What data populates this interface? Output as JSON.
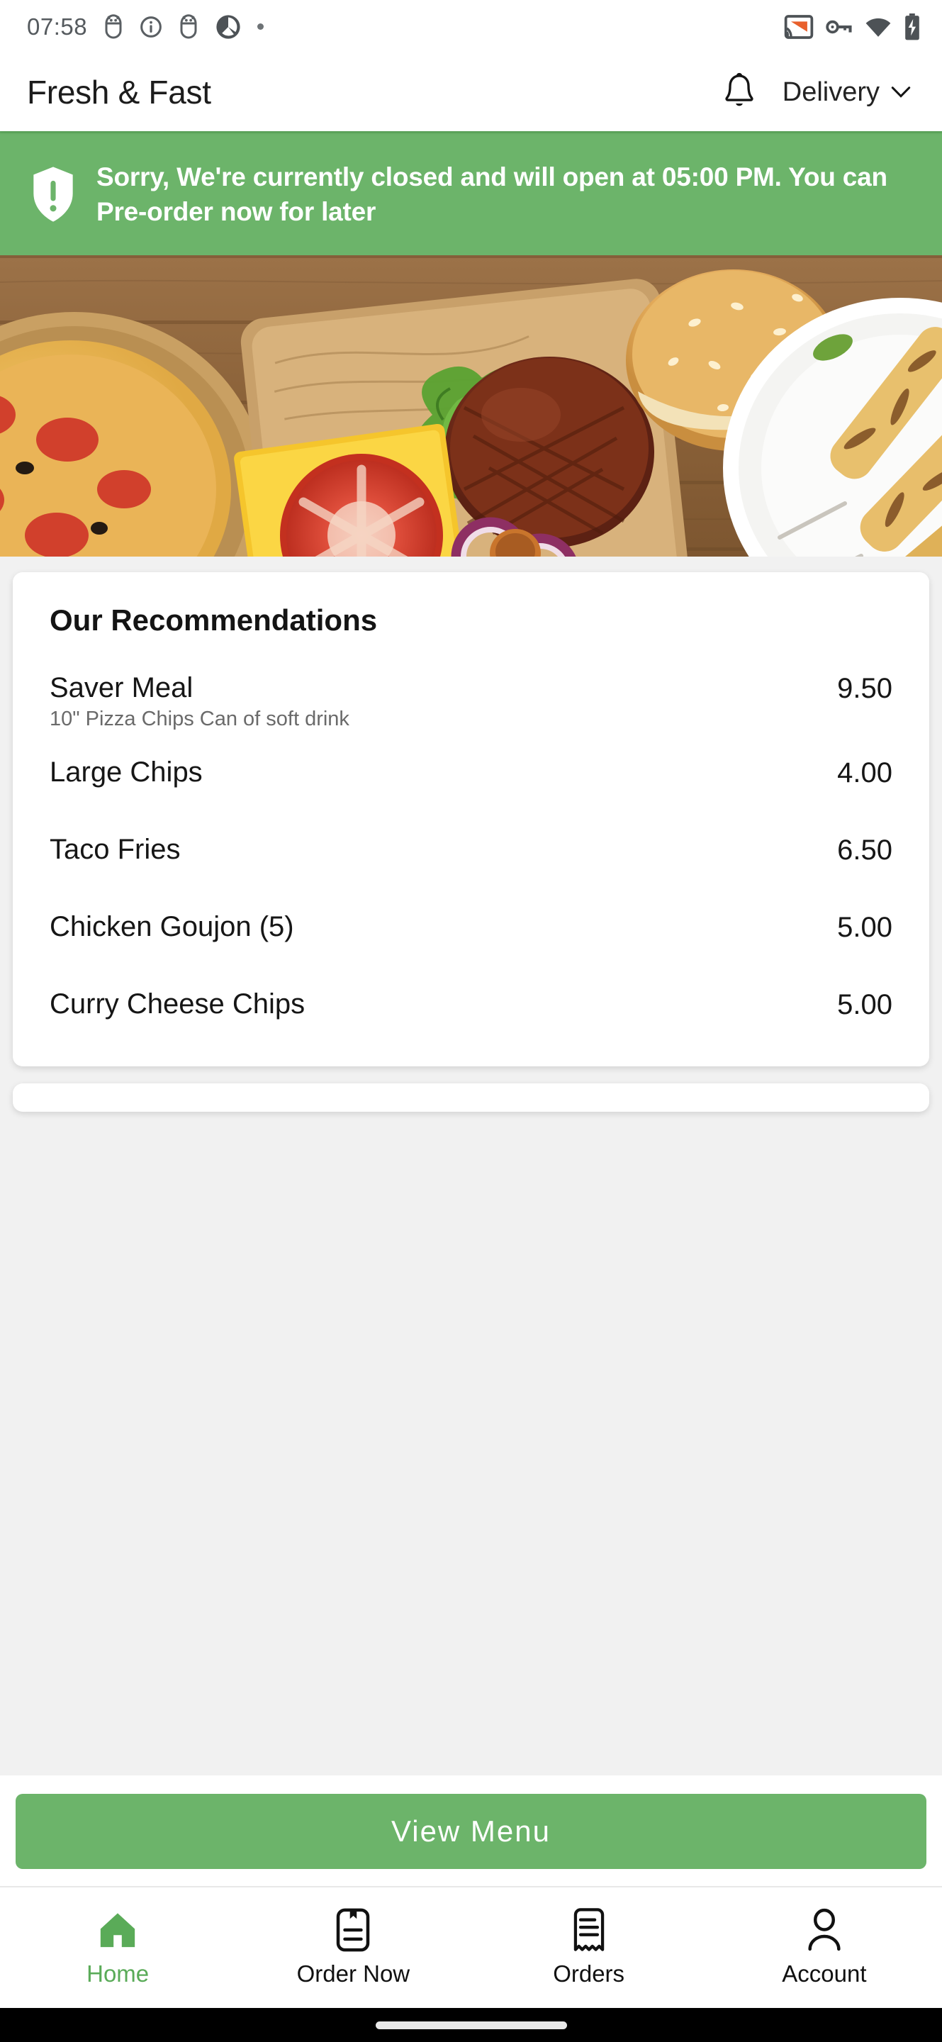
{
  "status_bar": {
    "time": "07:58",
    "left_icons": [
      "android-debug-icon",
      "info-circle-icon",
      "android-debug-icon",
      "app-sync-icon",
      "dot-indicator-icon"
    ],
    "right_icons": [
      "cast-icon",
      "vpn-key-icon",
      "wifi-icon",
      "battery-charging-icon"
    ],
    "cast_accent_color": "#E8602C"
  },
  "header": {
    "brand": "Fresh & Fast",
    "notification_icon": "bell-icon",
    "mode_label": "Delivery",
    "mode_chevron_icon": "chevron-down-icon"
  },
  "alert": {
    "icon": "shield-exclamation-icon",
    "message": "Sorry, We're currently closed and will open at 05:00 PM. You can Pre-order now for later",
    "background_color": "#6CB46A",
    "text_color": "#FFFFFF"
  },
  "hero": {
    "alt": "Assorted food on wooden table: pepperoni pizza, beef burger with lettuce tomato cheese and onion on cutting board, grilled chicken skewers on plate"
  },
  "recommendations": {
    "title": "Our Recommendations",
    "items": [
      {
        "name": "Saver Meal",
        "description": "10\" Pizza  Chips  Can of soft drink",
        "price": "9.50"
      },
      {
        "name": "Large Chips",
        "description": "",
        "price": "4.00"
      },
      {
        "name": "Taco Fries",
        "description": "",
        "price": "6.50"
      },
      {
        "name": "Chicken Goujon (5)",
        "description": "",
        "price": "5.00"
      },
      {
        "name": "Curry Cheese Chips",
        "description": "",
        "price": "5.00"
      }
    ]
  },
  "cta": {
    "label": "View Menu",
    "background_color": "#6CB46A"
  },
  "bottom_nav": {
    "active_color": "#5AAB58",
    "items": [
      {
        "label": "Home",
        "icon": "home-icon",
        "active": true
      },
      {
        "label": "Order Now",
        "icon": "menu-book-icon",
        "active": false
      },
      {
        "label": "Orders",
        "icon": "receipt-icon",
        "active": false
      },
      {
        "label": "Account",
        "icon": "person-icon",
        "active": false
      }
    ]
  }
}
